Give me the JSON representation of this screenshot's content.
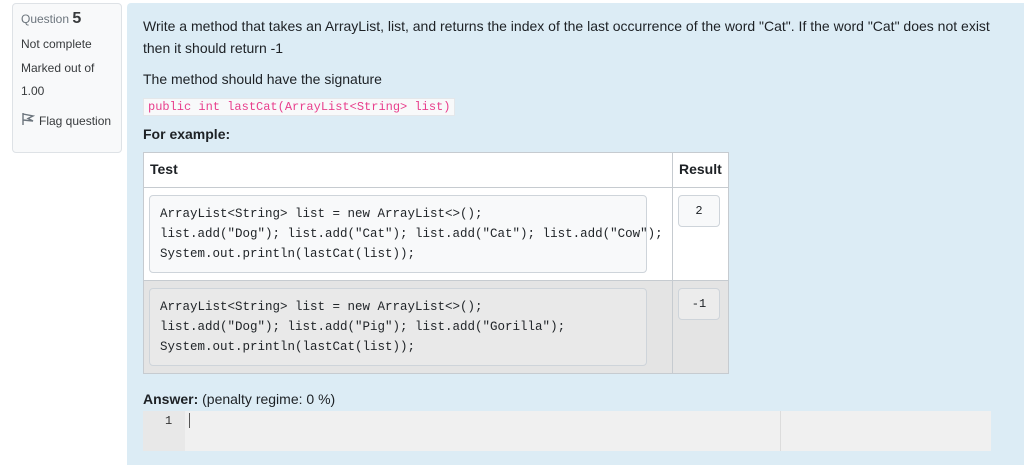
{
  "info": {
    "question_label": "Question",
    "question_number": "5",
    "status": "Not complete",
    "marked_out_of_label": "Marked out of",
    "marked_out_of_value": "1.00",
    "flag_label": "Flag question"
  },
  "question": {
    "text": "Write a method that takes an ArrayList, list, and returns the index of the last occurrence of the word \"Cat\".  If the word \"Cat\" does not exist then it should return -1",
    "signature_intro": "The method should have the signature",
    "signature_code": "public int lastCat(ArrayList<String> list)",
    "for_example": "For example:"
  },
  "examples": {
    "headers": {
      "test": "Test",
      "result": "Result"
    },
    "rows": [
      {
        "test": "ArrayList<String> list = new ArrayList<>();\nlist.add(\"Dog\"); list.add(\"Cat\"); list.add(\"Cat\"); list.add(\"Cow\");\nSystem.out.println(lastCat(list));",
        "result": "2"
      },
      {
        "test": "ArrayList<String> list = new ArrayList<>();\nlist.add(\"Dog\"); list.add(\"Pig\"); list.add(\"Gorilla\");\nSystem.out.println(lastCat(list));",
        "result": "-1"
      }
    ]
  },
  "answer": {
    "label": "Answer:",
    "penalty": "(penalty regime: 0 %)",
    "line_number": "1",
    "value": ""
  },
  "icons": {
    "flag": "flag-icon"
  }
}
